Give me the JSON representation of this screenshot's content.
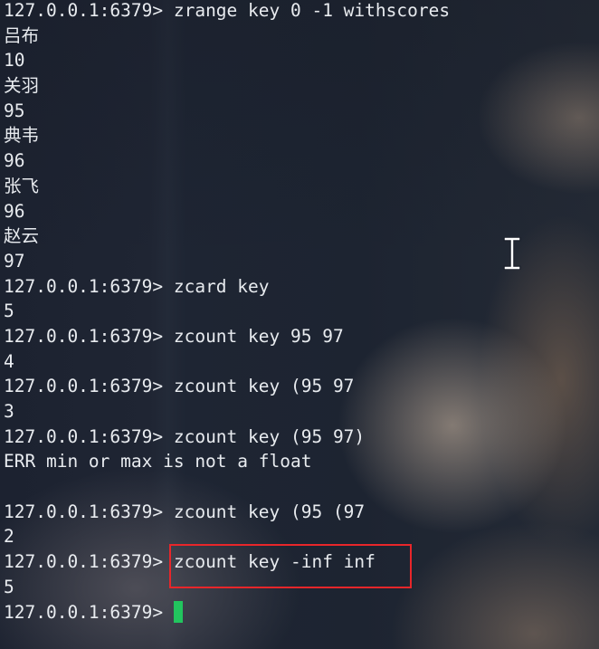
{
  "terminal": {
    "prompt": "127.0.0.1:6379> ",
    "lines": [
      {
        "kind": "cmd",
        "text": "zrange key 0 -1 withscores"
      },
      {
        "kind": "out",
        "text": "吕布"
      },
      {
        "kind": "out",
        "text": "10"
      },
      {
        "kind": "out",
        "text": "关羽"
      },
      {
        "kind": "out",
        "text": "95"
      },
      {
        "kind": "out",
        "text": "典韦"
      },
      {
        "kind": "out",
        "text": "96"
      },
      {
        "kind": "out",
        "text": "张飞"
      },
      {
        "kind": "out",
        "text": "96"
      },
      {
        "kind": "out",
        "text": "赵云"
      },
      {
        "kind": "out",
        "text": "97"
      },
      {
        "kind": "cmd",
        "text": "zcard key"
      },
      {
        "kind": "out",
        "text": "5"
      },
      {
        "kind": "cmd",
        "text": "zcount key 95 97"
      },
      {
        "kind": "out",
        "text": "4"
      },
      {
        "kind": "cmd",
        "text": "zcount key (95 97"
      },
      {
        "kind": "out",
        "text": "3"
      },
      {
        "kind": "cmd",
        "text": "zcount key (95 97)"
      },
      {
        "kind": "out",
        "text": "ERR min or max is not a float"
      },
      {
        "kind": "out",
        "text": ""
      },
      {
        "kind": "cmd",
        "text": "zcount key (95 (97"
      },
      {
        "kind": "out",
        "text": "2"
      },
      {
        "kind": "cmd",
        "text": "zcount key -inf inf"
      },
      {
        "kind": "out",
        "text": "5"
      },
      {
        "kind": "cmd",
        "text": ""
      }
    ],
    "cursor_color": "#22c55e",
    "highlight_color": "#e8262a",
    "text_color": "#e8ebef"
  },
  "icons": {
    "mouse_cursor": "text-ibeam-cursor-icon"
  }
}
